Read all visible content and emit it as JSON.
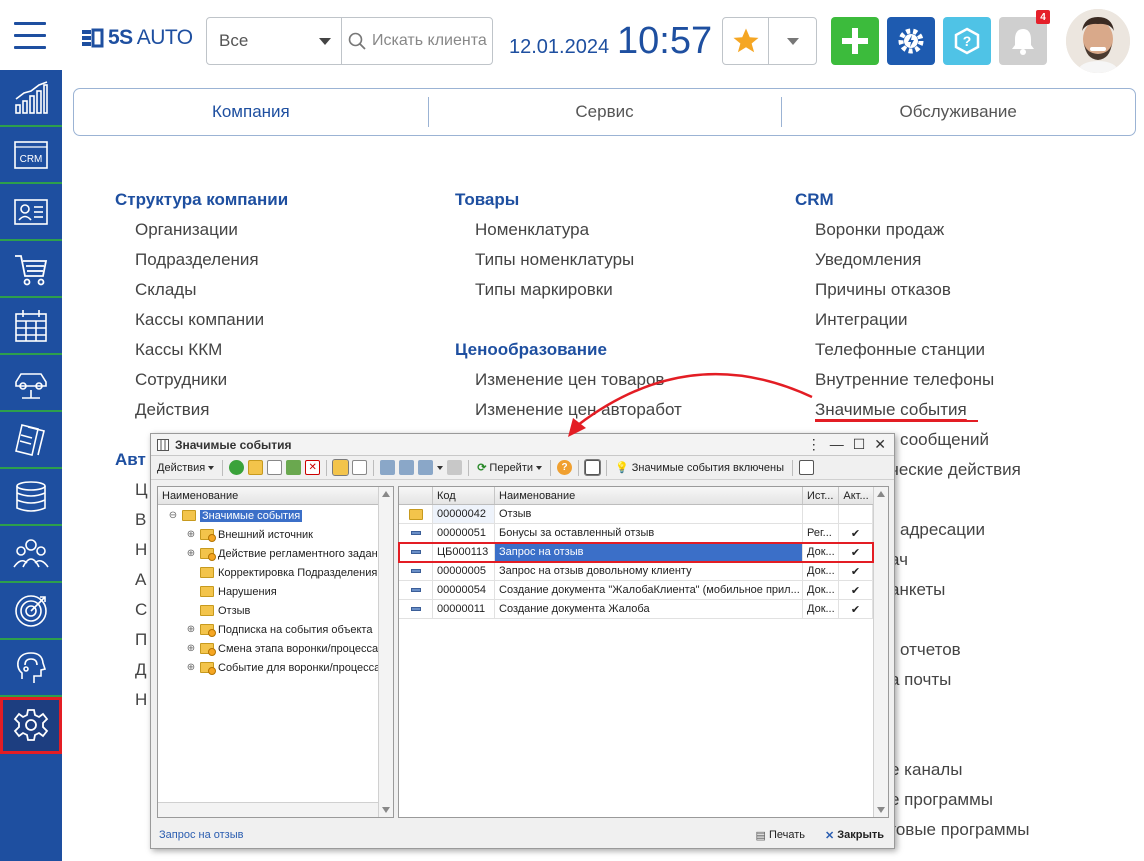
{
  "header": {
    "logo_mark": "5S",
    "logo_rest": "AUTO",
    "search_scope": "Все",
    "search_placeholder": "Искать клиента",
    "date": "12.01.2024",
    "time": "10:57",
    "notifications_count": "4"
  },
  "sidebar": {
    "items": [
      {
        "name": "analytics-icon"
      },
      {
        "name": "crm-icon",
        "label": "CRM"
      },
      {
        "name": "contacts-card-icon"
      },
      {
        "name": "shopping-cart-icon"
      },
      {
        "name": "calendar-icon"
      },
      {
        "name": "car-lift-icon"
      },
      {
        "name": "documents-icon"
      },
      {
        "name": "coins-icon"
      },
      {
        "name": "team-icon"
      },
      {
        "name": "target-icon"
      },
      {
        "name": "support-headset-icon"
      },
      {
        "name": "settings-gear-icon"
      }
    ]
  },
  "tabs": [
    {
      "label": "Компания",
      "active": true
    },
    {
      "label": "Сервис"
    },
    {
      "label": "Обслуживание"
    }
  ],
  "menu": {
    "col1": {
      "title": "Структура компании",
      "items": [
        "Организации",
        "Подразделения",
        "Склады",
        "Кассы компании",
        "Кассы ККМ",
        "Сотрудники",
        "Действия"
      ],
      "title2": "Авт",
      "items2": [
        "Ц",
        "В",
        "Н",
        "А",
        "С",
        "П",
        "Д",
        "Н"
      ]
    },
    "col2": {
      "title": "Товары",
      "items": [
        "Номенклатура",
        "Типы номенклатуры",
        "Типы маркировки"
      ],
      "title2": "Ценообразование",
      "items2": [
        "Изменение цен товаров",
        "Изменение цен авторабот"
      ]
    },
    "col3": {
      "title": "CRM",
      "items": [
        "Воронки продаж",
        "Уведомления",
        "Причины отказов",
        "Интеграции",
        "Телефонные станции",
        "Внутренние телефоны",
        "Значимые события",
        "сообщений",
        "ческие действия"
      ],
      "items_lower": [
        "адресации",
        "ач",
        "анкеты"
      ],
      "items_lower2": [
        "отчетов",
        "а почты"
      ],
      "items_bottom": [
        "е каналы",
        "е программы",
        "говые программы"
      ]
    }
  },
  "dialog": {
    "title": "Значимые события",
    "toolbar": {
      "actions_label": "Действия",
      "goto_label": "Перейти",
      "events_enabled_label": "Значимые события включены"
    },
    "tree_header": "Наименование",
    "tree_root": "Значимые события",
    "tree_items": [
      "Внешний источник",
      "Действие регламентного задания",
      "Корректировка Подразделения",
      "Нарушения",
      "Отзыв",
      "Подписка на события объекта",
      "Смена этапа воронки/процесса",
      "Событие для воронки/процесса"
    ],
    "grid_headers": [
      "",
      "Код",
      "Наименование",
      "Ист...",
      "Акт..."
    ],
    "grid_rows": [
      {
        "code": "00000042",
        "name": "Отзыв",
        "src": "",
        "act": "",
        "folder": true
      },
      {
        "code": "00000051",
        "name": "Бонусы за оставленный отзыв",
        "src": "Рег...",
        "act": "✔"
      },
      {
        "code": "ЦБ000113",
        "name": "Запрос на отзыв",
        "src": "Док...",
        "act": "✔",
        "selected": true
      },
      {
        "code": "00000005",
        "name": "Запрос на отзыв довольному клиенту",
        "src": "Док...",
        "act": "✔"
      },
      {
        "code": "00000054",
        "name": "Создание документа \"ЖалобаКлиента\" (мобильное прил...",
        "src": "Док...",
        "act": "✔"
      },
      {
        "code": "00000011",
        "name": "Создание документа Жалоба",
        "src": "Док...",
        "act": "✔"
      }
    ],
    "status_link": "Запрос на отзыв",
    "print_label": "Печать",
    "close_label": "Закрыть"
  },
  "colors": {
    "brand_blue": "#1e4fa0",
    "accent_red": "#e31d24",
    "green": "#3cbb3c"
  }
}
